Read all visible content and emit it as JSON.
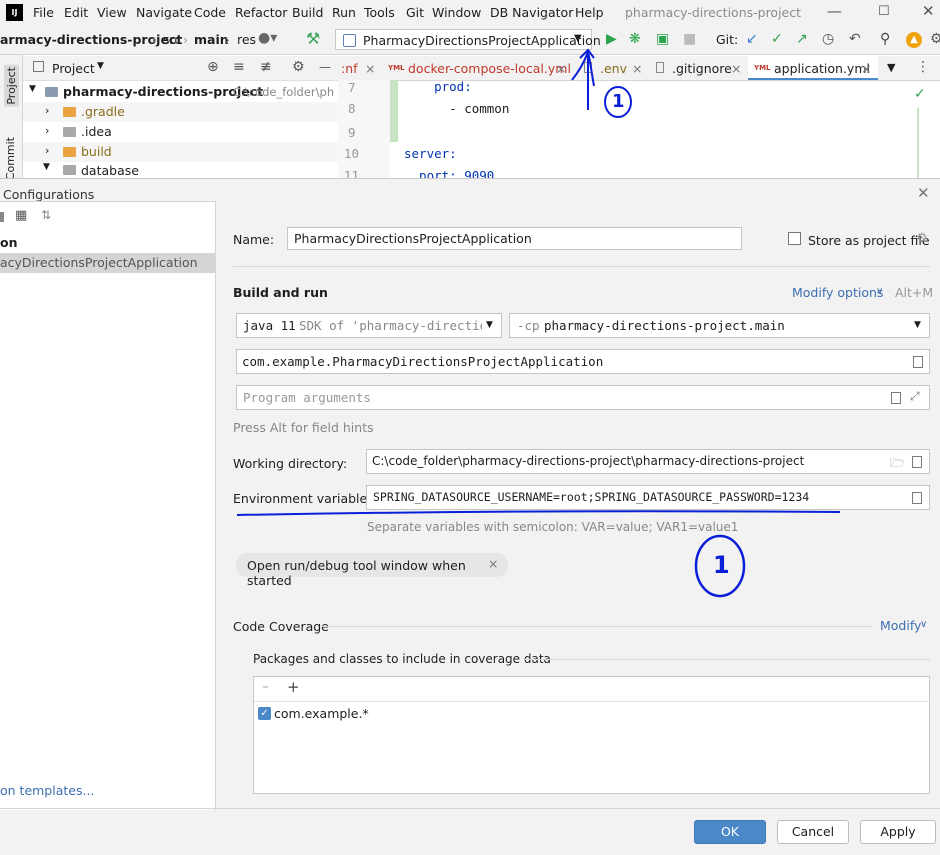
{
  "app": {
    "window_title": "pharmacy-directions-project",
    "logo_text": "IJ",
    "menu": [
      "File",
      "Edit",
      "View",
      "Navigate",
      "Code",
      "Refactor",
      "Build",
      "Run",
      "Tools",
      "Git",
      "Window",
      "DB Navigator",
      "Help"
    ]
  },
  "toolbar": {
    "breadcrumb": [
      "armacy-directions-project",
      "src",
      "main",
      "res"
    ],
    "run_config": "PharmacyDirectionsProjectApplication",
    "git_label": "Git:"
  },
  "project_panel": {
    "header": "Project",
    "root_name": "pharmacy-directions-project",
    "root_path": "C:\\code_folder\\ph",
    "items": [
      ".gradle",
      ".idea",
      "build",
      "database"
    ]
  },
  "side_strip": {
    "project": "Project",
    "commit": "Commit"
  },
  "editor": {
    "tabs": [
      ":nf",
      "docker-compose-local.yml",
      ".env",
      ".gitignore",
      "application.yml"
    ],
    "lines": [
      {
        "num": "7",
        "code": "    prod:"
      },
      {
        "num": "8",
        "code": "      - common"
      },
      {
        "num": "9",
        "code": ""
      },
      {
        "num": "10",
        "code": "server:"
      },
      {
        "num": "11",
        "code": "  port: 9090"
      }
    ]
  },
  "dialog": {
    "title": "Configurations",
    "tree_items": [
      "on",
      "acyDirectionsProjectApplication"
    ],
    "templates_link": "on templates...",
    "name_label": "Name:",
    "name_value": "PharmacyDirectionsProjectApplication",
    "store_label": "Store as project file",
    "build_run_label": "Build and run",
    "modify_options": "Modify options",
    "modify_shortcut": "Alt+M",
    "sdk_java": "java 11",
    "sdk_rest": "SDK of 'pharmacy-directior",
    "cp_prefix": "-cp",
    "cp_value": "pharmacy-directions-project.main",
    "main_class": "com.example.PharmacyDirectionsProjectApplication",
    "program_args_placeholder": "Program arguments",
    "hint": "Press Alt for field hints",
    "wd_label": "Working directory:",
    "wd_value": "C:\\code_folder\\pharmacy-directions-project\\pharmacy-directions-project",
    "env_label": "Environment variables:",
    "env_value": "SPRING_DATASOURCE_USERNAME=root;SPRING_DATASOURCE_PASSWORD=1234",
    "env_hint": "Separate variables with semicolon: VAR=value; VAR1=value1",
    "open_tool_window": "Open run/debug tool window when started",
    "code_coverage": "Code Coverage",
    "modify": "Modify",
    "packages_label": "Packages and classes to include in coverage data",
    "coverage_item": "com.example.*",
    "ok": "OK",
    "cancel": "Cancel",
    "apply": "Apply"
  },
  "annotations": {
    "one": "1",
    "two": "1"
  },
  "colors": {
    "accent": "#4a88c7",
    "run_green": "#2da44e",
    "annotation_blue": "#0a1fd8"
  }
}
